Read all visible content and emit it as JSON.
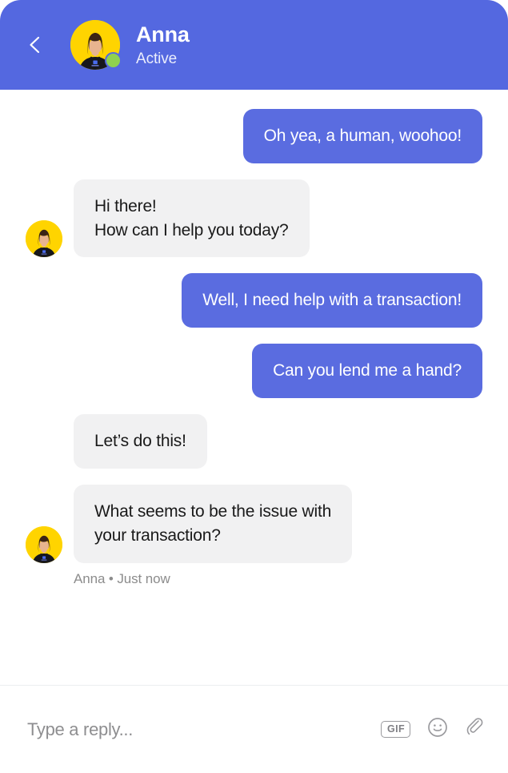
{
  "window": {
    "app_name": "chat-messenger"
  },
  "header": {
    "back_icon": "chevron-left-icon",
    "avatar_icon": "user-avatar-anna",
    "name": "Anna",
    "status": "Active",
    "status_indicator": "online-dot",
    "bg_color": "#5468e0",
    "status_dot_color": "#8fd14f",
    "avatar_bg_color": "#ffd400"
  },
  "conversation": {
    "messages": [
      {
        "id": "m1",
        "direction": "out",
        "text": "Oh yea, a human, woohoo!",
        "avatar": false
      },
      {
        "id": "m2",
        "direction": "in",
        "text": "Hi there!\nHow can I help you today?",
        "avatar": true
      },
      {
        "id": "m3",
        "direction": "out",
        "text": "Well, I need help with a transaction!",
        "avatar": false
      },
      {
        "id": "m4",
        "direction": "out",
        "text": "Can you lend me a hand?",
        "avatar": false
      },
      {
        "id": "m5",
        "direction": "in",
        "text": "Let’s do this!",
        "avatar": false
      },
      {
        "id": "m6",
        "direction": "in",
        "text": "What seems to be the issue with\nyour transaction?",
        "avatar": true
      }
    ],
    "last_message_meta": "Anna • Just now",
    "out_bubble_color": "#5a6ce0",
    "in_bubble_color": "#f1f1f2"
  },
  "composer": {
    "placeholder": "Type a reply...",
    "value": "",
    "actions": [
      {
        "name": "gif-icon",
        "label": "GIF"
      },
      {
        "name": "emoji-icon",
        "label": ""
      },
      {
        "name": "attachment-icon",
        "label": ""
      }
    ]
  }
}
